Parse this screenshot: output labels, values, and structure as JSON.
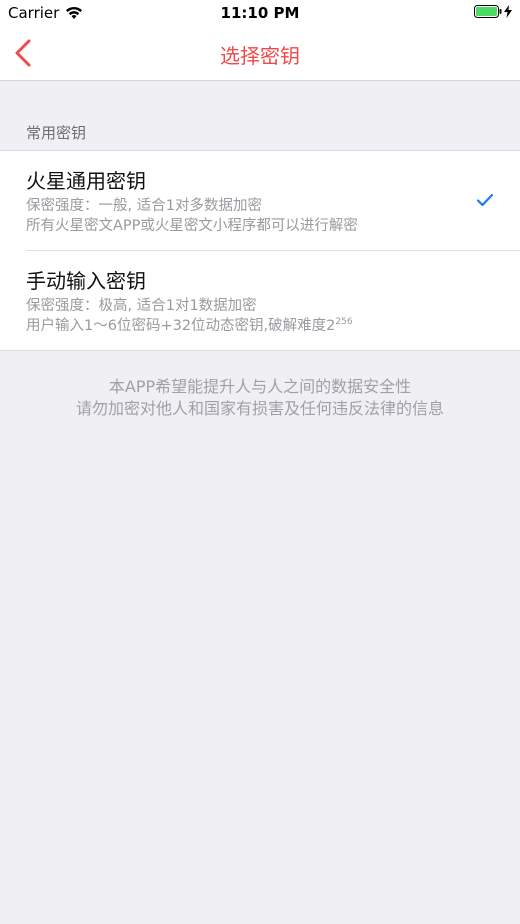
{
  "status_bar": {
    "carrier": "Carrier",
    "time": "11:10 PM"
  },
  "nav": {
    "title": "选择密钥",
    "accent_color": "#f04a4a"
  },
  "section": {
    "header": "常用密钥"
  },
  "options": [
    {
      "title": "火星通用密钥",
      "line1": "保密强度：一般, 适合1对多数据加密",
      "line2": "所有火星密文APP或火星密文小程序都可以进行解密",
      "selected": true
    },
    {
      "title": "手动输入密钥",
      "line1": "保密强度：极高, 适合1对1数据加密",
      "line2_prefix": "用户输入1～6位密码+32位动态密钥,破解难度2",
      "line2_sup": "256",
      "selected": false
    }
  ],
  "footer": {
    "line1": "本APP希望能提升人与人之间的数据安全性",
    "line2": "请勿加密对他人和国家有损害及任何违反法律的信息"
  },
  "icons": {
    "check_color": "#1a7cf5",
    "back": "chevron-left-icon"
  }
}
